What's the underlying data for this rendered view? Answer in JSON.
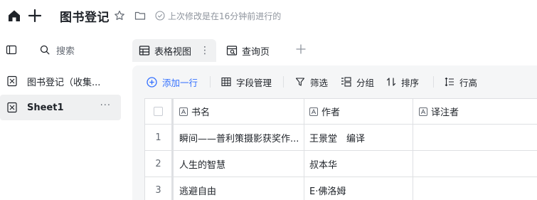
{
  "app": {
    "title": "图书登记",
    "save_status": "上次修改是在16分钟前进行的"
  },
  "sidebar": {
    "search_placeholder": "搜索",
    "items": [
      {
        "label": "图书登记（收集..."
      },
      {
        "label": "Sheet1",
        "more": "···"
      }
    ]
  },
  "view_tabs": [
    {
      "label": "表格视图",
      "more": "⋮"
    },
    {
      "label": "查询页"
    }
  ],
  "toolbar": {
    "add_row": "添加一行",
    "field_manage": "字段管理",
    "filter": "筛选",
    "group": "分组",
    "sort": "排序",
    "row_height": "行高"
  },
  "table": {
    "columns": [
      "书名",
      "作者",
      "译注者"
    ],
    "rows": [
      {
        "index": "1",
        "cells": [
          "瞬间——普利策摄影获奖作...",
          "王景堂　编译",
          ""
        ]
      },
      {
        "index": "2",
        "cells": [
          "人生的智慧",
          "叔本华",
          ""
        ]
      },
      {
        "index": "3",
        "cells": [
          "逃避自由",
          "E·佛洛姆",
          ""
        ]
      }
    ]
  },
  "colors": {
    "accent": "#3370ff",
    "text": "#1f2329",
    "muted": "#8f959e",
    "border": "#dee0e3",
    "content_bg": "#f5f6f7"
  }
}
